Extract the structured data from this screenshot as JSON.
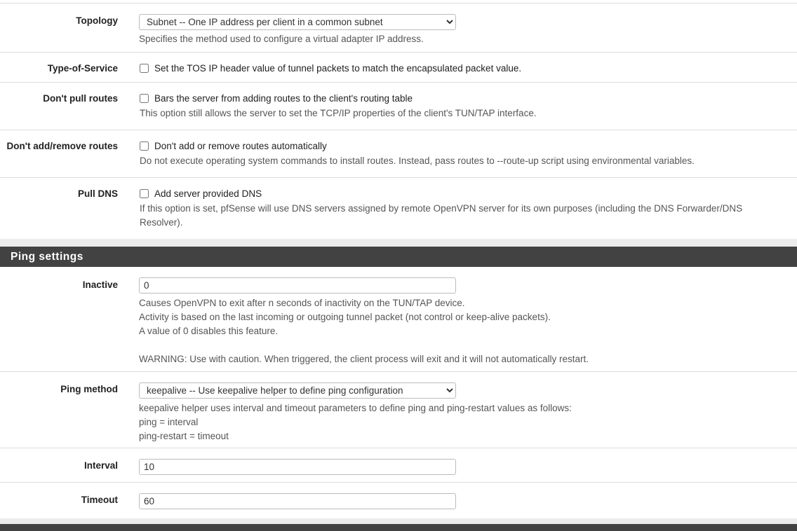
{
  "advanced": {
    "topology": {
      "label": "Topology",
      "value": "Subnet -- One IP address per client in a common subnet",
      "help": "Specifies the method used to configure a virtual adapter IP address."
    },
    "tos": {
      "label": "Type-of-Service",
      "checkbox": "Set the TOS IP header value of tunnel packets to match the encapsulated packet value.",
      "checked": false
    },
    "no_pull": {
      "label": "Don't pull routes",
      "checkbox": "Bars the server from adding routes to the client's routing table",
      "help": "This option still allows the server to set the TCP/IP properties of the client's TUN/TAP interface.",
      "checked": false
    },
    "no_add": {
      "label": "Don't add/remove routes",
      "checkbox": "Don't add or remove routes automatically",
      "help": "Do not execute operating system commands to install routes. Instead, pass routes to --route-up script using environmental variables.",
      "checked": false
    },
    "pull_dns": {
      "label": "Pull DNS",
      "checkbox": "Add server provided DNS",
      "help": "If this option is set, pfSense will use DNS servers assigned by remote OpenVPN server for its own purposes (including the DNS Forwarder/DNS Resolver).",
      "checked": false
    }
  },
  "ping": {
    "title": "Ping settings",
    "inactive": {
      "label": "Inactive",
      "value": "0",
      "help1": "Causes OpenVPN to exit after n seconds of inactivity on the TUN/TAP device.",
      "help2": "Activity is based on the last incoming or outgoing tunnel packet (not control or keep-alive packets).",
      "help3": "A value of 0 disables this feature.",
      "help4": "WARNING: Use with caution. When triggered, the client process will exit and it will not automatically restart."
    },
    "method": {
      "label": "Ping method",
      "value": "keepalive -- Use keepalive helper to define ping configuration",
      "help1": "keepalive helper uses interval and timeout parameters to define ping and ping-restart values as follows:",
      "help2": "ping = interval",
      "help3": "ping-restart = timeout"
    },
    "interval": {
      "label": "Interval",
      "value": "10"
    },
    "timeout": {
      "label": "Timeout",
      "value": "60"
    }
  }
}
